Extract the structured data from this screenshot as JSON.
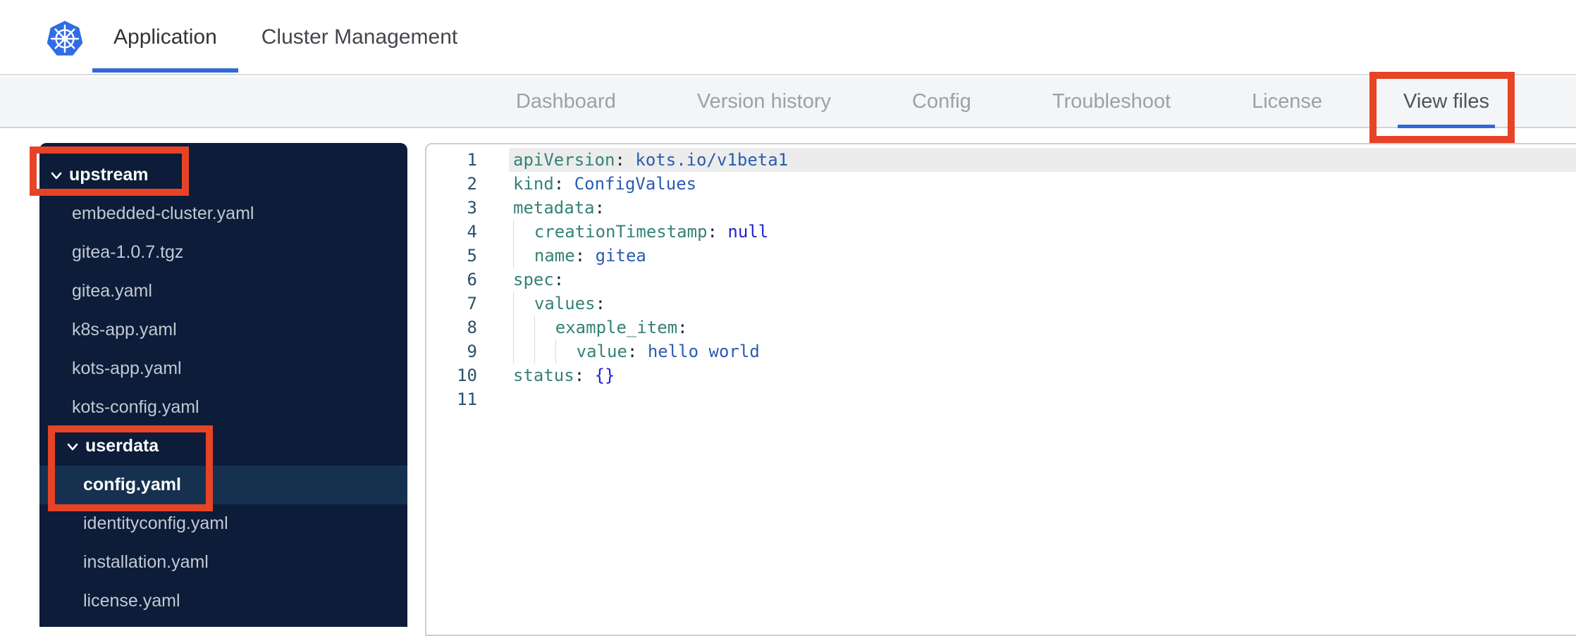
{
  "topbar": {
    "logo": "kubernetes-logo",
    "tabs": [
      {
        "label": "Application",
        "active": true
      },
      {
        "label": "Cluster Management",
        "active": false
      }
    ]
  },
  "nav": {
    "tabs": [
      {
        "label": "Dashboard",
        "active": false
      },
      {
        "label": "Version history",
        "active": false
      },
      {
        "label": "Config",
        "active": false
      },
      {
        "label": "Troubleshoot",
        "active": false
      },
      {
        "label": "License",
        "active": false
      },
      {
        "label": "View files",
        "active": true
      }
    ]
  },
  "file_tree": {
    "items": [
      {
        "type": "folder",
        "label": "upstream",
        "depth": 0,
        "expanded": true
      },
      {
        "type": "file",
        "label": "embedded-cluster.yaml",
        "depth": 1
      },
      {
        "type": "file",
        "label": "gitea-1.0.7.tgz",
        "depth": 1
      },
      {
        "type": "file",
        "label": "gitea.yaml",
        "depth": 1
      },
      {
        "type": "file",
        "label": "k8s-app.yaml",
        "depth": 1
      },
      {
        "type": "file",
        "label": "kots-app.yaml",
        "depth": 1
      },
      {
        "type": "file",
        "label": "kots-config.yaml",
        "depth": 1
      },
      {
        "type": "folder",
        "label": "userdata",
        "depth": 1,
        "expanded": true
      },
      {
        "type": "file",
        "label": "config.yaml",
        "depth": 2,
        "selected": true
      },
      {
        "type": "file",
        "label": "identityconfig.yaml",
        "depth": 2
      },
      {
        "type": "file",
        "label": "installation.yaml",
        "depth": 2
      },
      {
        "type": "file",
        "label": "license.yaml",
        "depth": 2
      }
    ]
  },
  "editor": {
    "language": "yaml",
    "lines": [
      {
        "num": 1,
        "indent": 0,
        "active": true,
        "tokens": [
          [
            "key",
            "apiVersion"
          ],
          [
            "punc",
            ":"
          ],
          [
            "str",
            " kots.io/v1beta1"
          ]
        ]
      },
      {
        "num": 2,
        "indent": 0,
        "tokens": [
          [
            "key",
            "kind"
          ],
          [
            "punc",
            ":"
          ],
          [
            "str",
            " ConfigValues"
          ]
        ]
      },
      {
        "num": 3,
        "indent": 0,
        "tokens": [
          [
            "key",
            "metadata"
          ],
          [
            "punc",
            ":"
          ]
        ]
      },
      {
        "num": 4,
        "indent": 2,
        "tokens": [
          [
            "key",
            "creationTimestamp"
          ],
          [
            "punc",
            ":"
          ],
          [
            "atom",
            " null"
          ]
        ]
      },
      {
        "num": 5,
        "indent": 2,
        "tokens": [
          [
            "key",
            "name"
          ],
          [
            "punc",
            ":"
          ],
          [
            "str",
            " gitea"
          ]
        ]
      },
      {
        "num": 6,
        "indent": 0,
        "tokens": [
          [
            "key",
            "spec"
          ],
          [
            "punc",
            ":"
          ]
        ]
      },
      {
        "num": 7,
        "indent": 2,
        "tokens": [
          [
            "key",
            "values"
          ],
          [
            "punc",
            ":"
          ]
        ]
      },
      {
        "num": 8,
        "indent": 4,
        "tokens": [
          [
            "key",
            "example_item"
          ],
          [
            "punc",
            ":"
          ]
        ]
      },
      {
        "num": 9,
        "indent": 6,
        "tokens": [
          [
            "key",
            "value"
          ],
          [
            "punc",
            ":"
          ],
          [
            "str",
            " hello world"
          ]
        ]
      },
      {
        "num": 10,
        "indent": 0,
        "tokens": [
          [
            "key",
            "status"
          ],
          [
            "punc",
            ":"
          ],
          [
            "atom",
            " {}"
          ]
        ]
      },
      {
        "num": 11,
        "indent": 0,
        "tokens": []
      }
    ]
  },
  "annotations": {
    "color": "#e64327",
    "boxes": [
      {
        "target": "upstream-folder"
      },
      {
        "target": "userdata-and-config-yaml"
      },
      {
        "target": "view-files-tab"
      }
    ]
  },
  "colors": {
    "accent_blue": "#3069d6",
    "kubernetes_blue": "#326ce5",
    "sidebar_bg": "#0c1c39",
    "sidebar_selected_bg": "#16314f",
    "code_key": "#358277",
    "code_string": "#2a5cb0",
    "code_atom": "#2121cf",
    "annotation_red": "#e64327"
  }
}
